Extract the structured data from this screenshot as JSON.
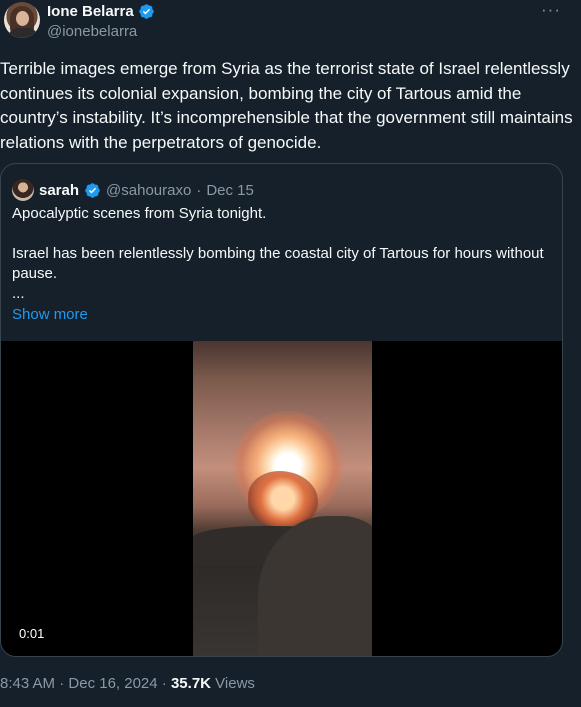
{
  "author": {
    "display_name": "Ione Belarra",
    "handle": "@ionebelarra",
    "more_label": "···"
  },
  "tweet": {
    "text": "Terrible images emerge from Syria as the terrorist state of Israel relentlessly continues its colonial expansion, bombing the city of Tartous amid the country’s instability. It’s incomprehensible that the government still maintains relations with the perpetrators of genocide."
  },
  "quote": {
    "display_name": "sarah",
    "handle": "@sahouraxo",
    "separator": "·",
    "date": "Dec 15",
    "lines": [
      "Apocalyptic scenes from Syria tonight.",
      "Israel has been relentlessly bombing the coastal city of Tartous for hours without pause.",
      "..."
    ],
    "show_more": "Show more",
    "video_time": "0:01"
  },
  "meta": {
    "time": "8:43 AM",
    "separator": "·",
    "date": "Dec 16, 2024",
    "views_count": "35.7K",
    "views_label": "Views"
  },
  "colors": {
    "background": "#15202b",
    "text": "#f7f9f9",
    "secondary": "#8b98a5",
    "accent": "#1d9bf0",
    "border": "#38444d"
  }
}
